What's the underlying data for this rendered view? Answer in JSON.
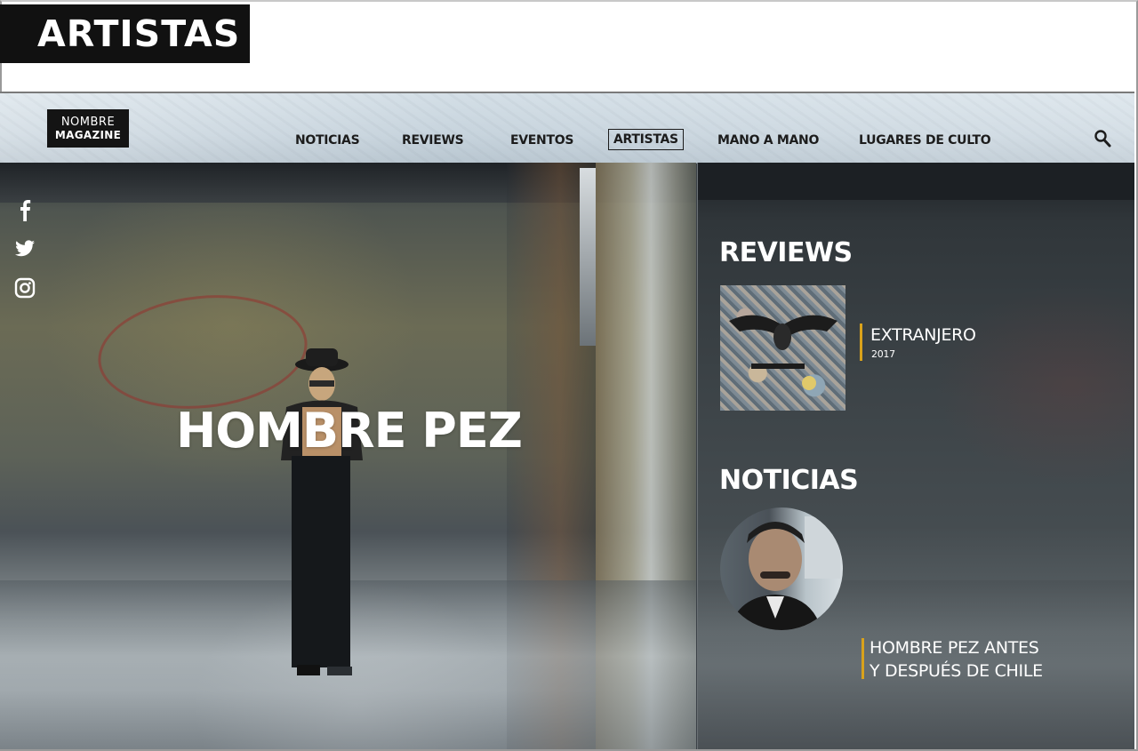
{
  "page_label": "ARTISTAS",
  "logo": {
    "line1": "NOMBRE",
    "line2": "MAGAZINE"
  },
  "nav": {
    "items": [
      {
        "label": "NOTICIAS"
      },
      {
        "label": "REVIEWS"
      },
      {
        "label": "EVENTOS"
      },
      {
        "label": "ARTISTAS",
        "active": true
      },
      {
        "label": "MANO A MANO"
      },
      {
        "label": "LUGARES DE CULTO"
      }
    ],
    "search_icon": "search-icon"
  },
  "social": [
    "facebook-icon",
    "twitter-icon",
    "instagram-icon"
  ],
  "hero": {
    "artist_name": "HOMBRE PEZ"
  },
  "sidebar": {
    "reviews": {
      "heading": "REVIEWS",
      "item": {
        "title": "EXTRANJERO",
        "year": "2017"
      }
    },
    "noticias": {
      "heading": "NOTICIAS",
      "item": {
        "title_line1": "HOMBRE PEZ ANTES",
        "title_line2": "Y DESPUÉS DE CHILE"
      }
    }
  },
  "colors": {
    "accent": "#d9a21b",
    "label_bg": "#111111",
    "text_on_dark": "#ffffff"
  }
}
